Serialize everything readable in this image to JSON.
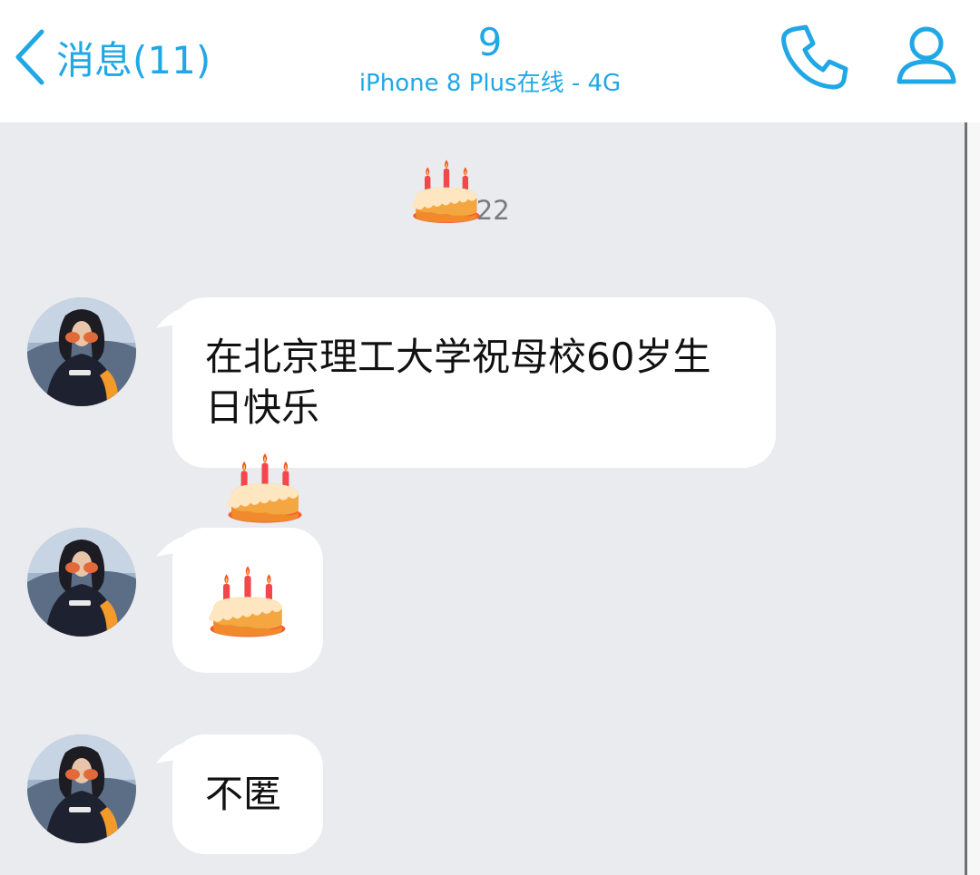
{
  "header": {
    "back_label": "消息(11)",
    "title": "9",
    "subtitle": "iPhone 8 Plus在线 - 4G"
  },
  "icons": {
    "back": "chevron-left-icon",
    "call": "phone-icon",
    "profile": "person-icon",
    "emoji": "birthday-cake-emoji"
  },
  "colors": {
    "accent": "#20a7e6",
    "chat_background": "#eaebef",
    "bubble": "#ffffff"
  },
  "chat": {
    "timestamp": ":22",
    "messages": [
      {
        "sender": "other",
        "text": "在北京理工大学祝母校60岁生日快乐"
      },
      {
        "sender": "other",
        "type": "emoji",
        "emoji": "birthday-cake"
      },
      {
        "sender": "other",
        "text": "不匿"
      }
    ]
  }
}
